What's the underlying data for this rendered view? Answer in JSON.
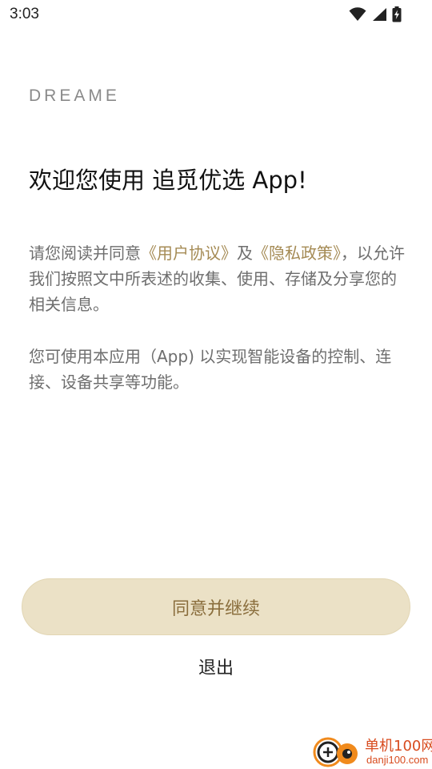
{
  "status_bar": {
    "time": "3:03",
    "icons": [
      "wifi-icon",
      "signal-icon",
      "battery-charging-icon"
    ]
  },
  "brand": {
    "logo_text": "DREAME"
  },
  "welcome": {
    "title": "欢迎您使用 追觅优选 App!"
  },
  "agreement": {
    "text_before": "请您阅读并同意",
    "user_agreement_link": "《用户协议》",
    "connector": "及",
    "privacy_policy_link": "《隐私政策》",
    "text_after": "，以允许我们按照文中所表述的收集、使用、存储及分享您的相关信息。"
  },
  "description": {
    "text": "您可使用本应用（App) 以实现智能设备的控制、连接、设备共享等功能。"
  },
  "actions": {
    "agree_label": "同意并继续",
    "exit_label": "退出"
  },
  "watermark": {
    "cn": "单机100网",
    "en": "danji100.com"
  },
  "colors": {
    "link": "#a58b55",
    "button_bg": "#ebe1c6",
    "button_text": "#8a6e3d",
    "body_text": "#6e6e6e",
    "watermark": "#d84b1e"
  }
}
